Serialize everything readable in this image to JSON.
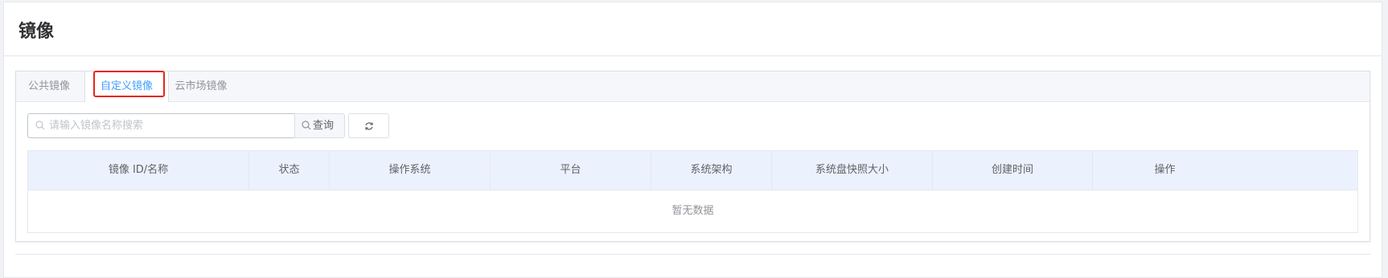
{
  "page": {
    "title": "镜像"
  },
  "tabs": [
    {
      "label": "公共镜像",
      "active": false
    },
    {
      "label": "自定义镜像",
      "active": true
    },
    {
      "label": "云市场镜像",
      "active": false
    }
  ],
  "search": {
    "placeholder": "请输入镜像名称搜索",
    "query_label": "查询"
  },
  "icons": {
    "search": "search-icon",
    "refresh": "refresh-icon"
  },
  "table": {
    "columns": [
      "镜像 ID/名称",
      "状态",
      "操作系统",
      "平台",
      "系统架构",
      "系统盘快照大小",
      "创建时间",
      "操作"
    ],
    "empty_text": "暂无数据"
  },
  "colors": {
    "accent": "#409eff",
    "highlight": "#e5261b",
    "header_bg": "#ebf2fd"
  }
}
